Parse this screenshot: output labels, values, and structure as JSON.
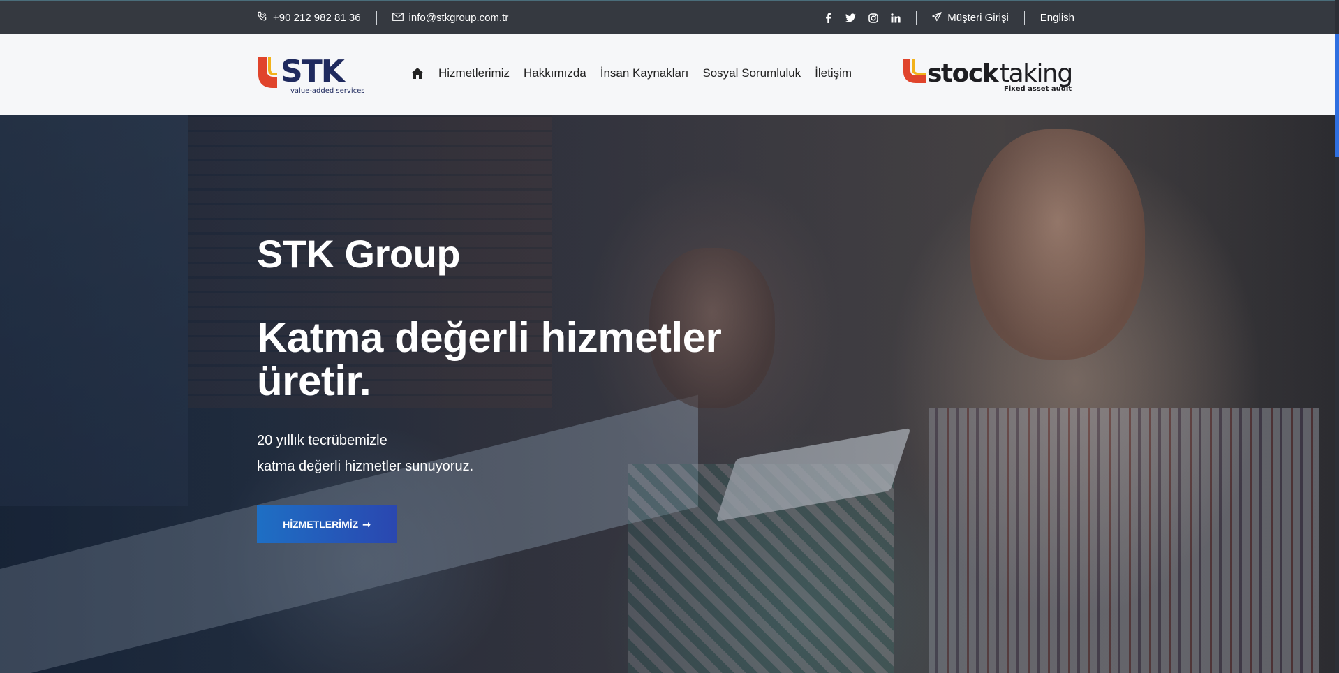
{
  "topbar": {
    "phone": "+90 212 982 81 36",
    "email": "info@stkgroup.com.tr",
    "social": [
      "facebook-icon",
      "twitter-icon",
      "instagram-icon",
      "linkedin-icon"
    ],
    "client_login": "Müşteri Girişi",
    "language": "English"
  },
  "header": {
    "logo_text": "STK",
    "logo_tagline": "value-added services",
    "nav": [
      "Hizmetlerimiz",
      "Hakkımızda",
      "İnsan Kaynakları",
      "Sosyal Sorumluluk",
      "İletişim"
    ],
    "partner_logo_bold": "stock",
    "partner_logo_light": "taking",
    "partner_tagline": "Fixed asset audit"
  },
  "hero": {
    "brand": "STK Group",
    "headline": "Katma değerli hizmetler üretir.",
    "desc_line1": "20 yıllık tecrübemizle",
    "desc_line2": "katma değerli hizmetler sunuyoruz.",
    "cta": "HİZMETLERİMİZ",
    "cta_arrow": "➞"
  },
  "colors": {
    "topbar_bg": "#353940",
    "header_bg": "#f6f7f9",
    "logo_red": "#e0442c",
    "logo_yellow": "#f2b21b",
    "logo_navy": "#1f2a5e",
    "cta_start": "#1e6fc4",
    "cta_end": "#2a47b0"
  }
}
